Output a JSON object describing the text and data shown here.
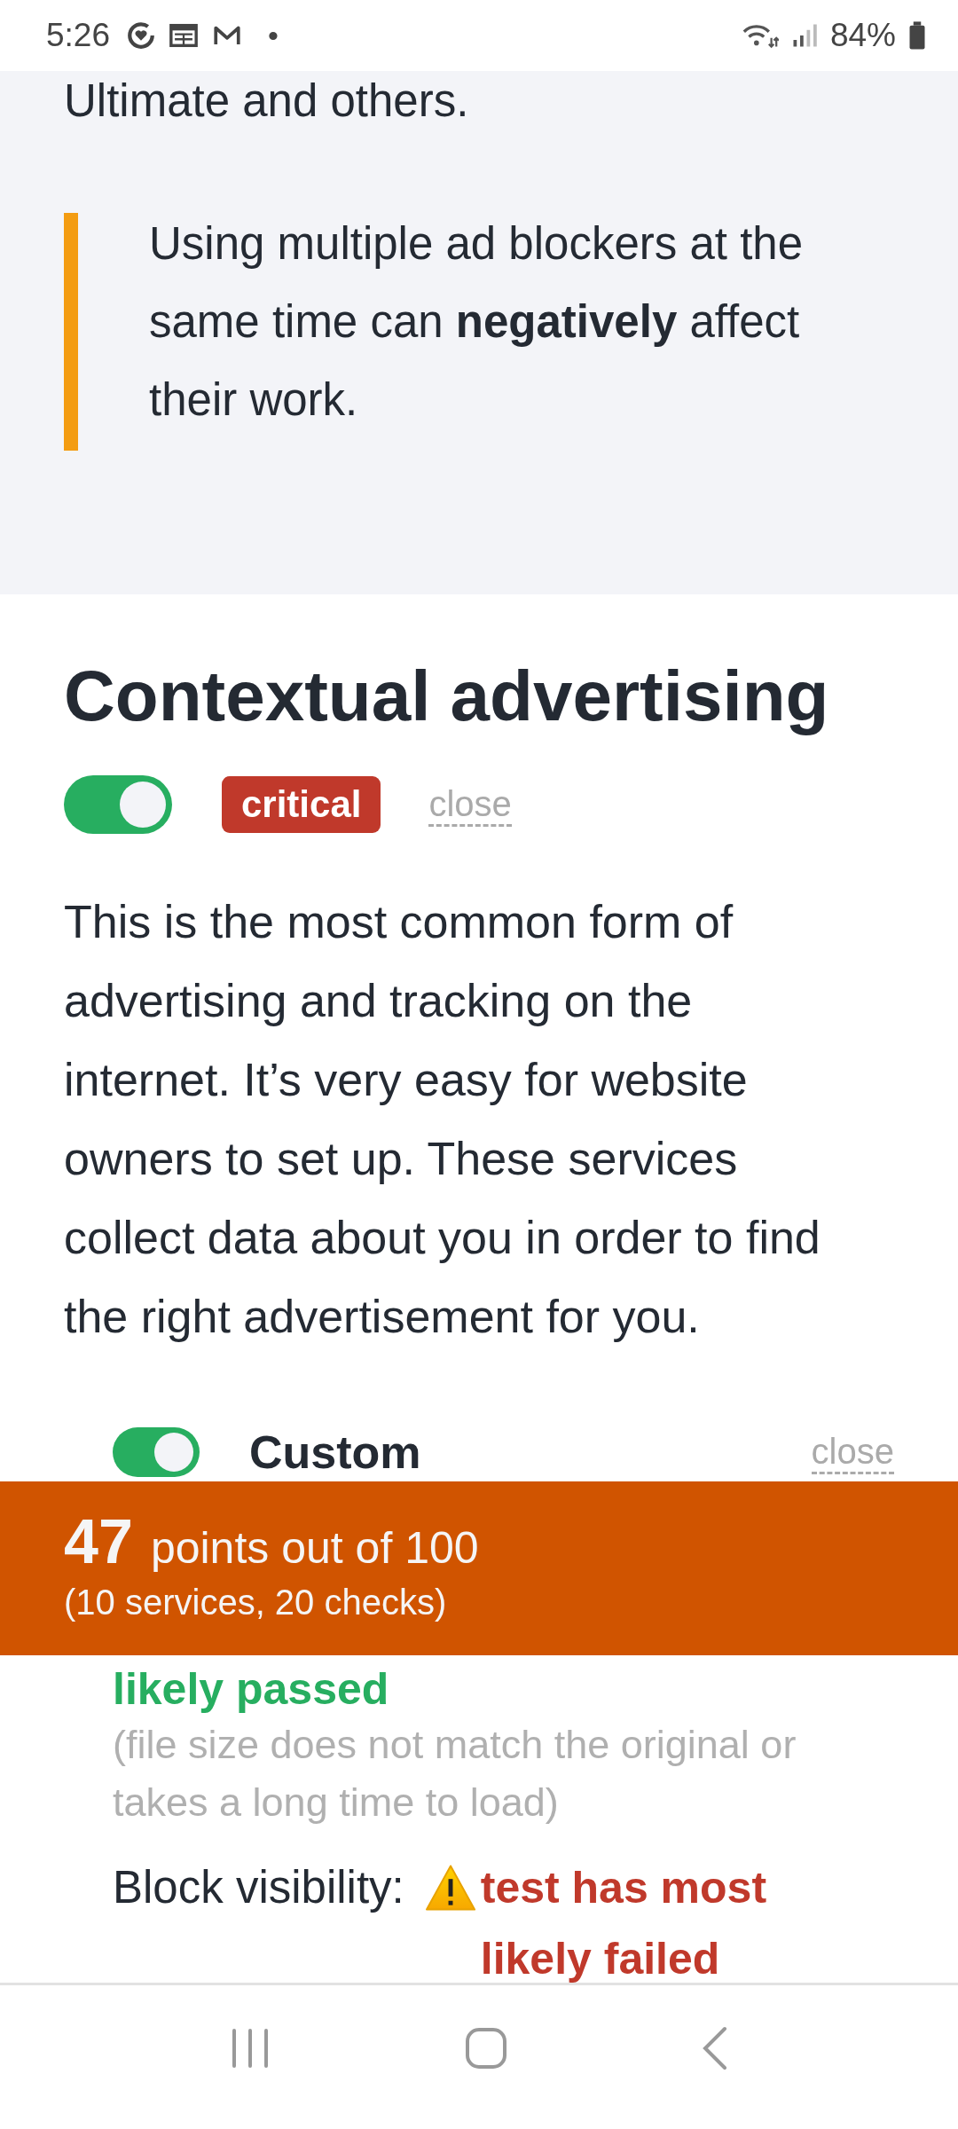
{
  "status_bar": {
    "time": "5:26",
    "battery": "84%",
    "notification_dot": "•"
  },
  "intro": {
    "tail_text": "Ultimate and others.",
    "note": "Using multiple ad blockers at the same time can **negatively** affect their work."
  },
  "section": {
    "title": "Contextual advertising",
    "toggle_on": true,
    "badge": "critical",
    "close_link": "close",
    "description": "This is the most common form of advertising and tracking on the internet. It’s very easy for website owners to set up. These services collect data about you in order to find the right advertisement for you."
  },
  "service": {
    "toggle_on": true,
    "name": "Custom",
    "close_link": "close"
  },
  "checks": [
    {
      "kind": "continued",
      "result": "likely passed",
      "passed": true,
      "note": "(file size does not match the original or takes a long time to load)"
    },
    {
      "kind": "labelled",
      "label": "Block visibility:",
      "result": "test has most likely failed",
      "passed": false
    }
  ],
  "score_banner": {
    "score": "47",
    "label": "points out of 100",
    "detail": "(10 services, 20 checks)"
  }
}
